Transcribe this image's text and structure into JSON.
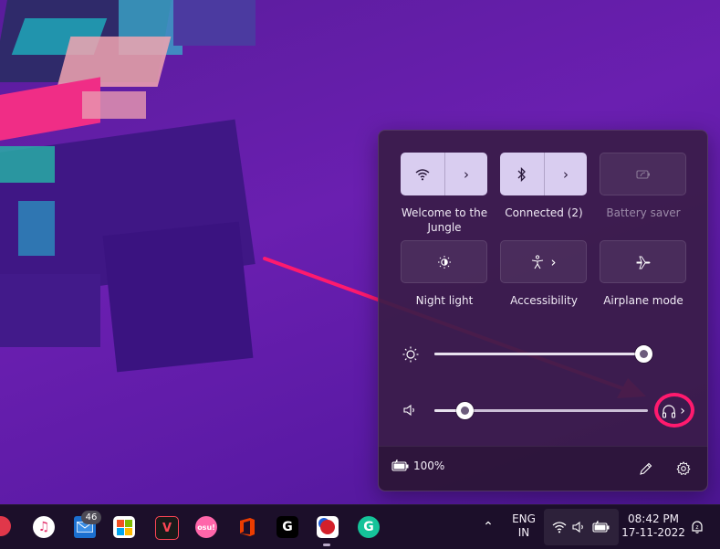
{
  "quick_settings": {
    "tiles": [
      {
        "label": "Welcome to the Jungle",
        "icon": "wifi-icon",
        "active": true
      },
      {
        "label": "Connected (2)",
        "icon": "bluetooth-icon",
        "active": true
      },
      {
        "label": "Battery saver",
        "icon": "battery-saver-icon",
        "active": false
      },
      {
        "label": "Night light",
        "icon": "night-light-icon",
        "active": false
      },
      {
        "label": "Accessibility",
        "icon": "accessibility-icon",
        "active": false
      },
      {
        "label": "Airplane mode",
        "icon": "airplane-icon",
        "active": false
      }
    ],
    "brightness": {
      "icon": "sun-icon",
      "level": 0.98
    },
    "volume": {
      "icon": "speaker-icon",
      "level": 0.14,
      "output_icon": "headphones-icon"
    },
    "footer": {
      "battery_text": "100%",
      "edit_icon": "pencil-icon",
      "settings_icon": "gear-icon"
    }
  },
  "taskbar": {
    "mail_badge": "46",
    "lang_line1": "ENG",
    "lang_line2": "IN",
    "time": "08:42 PM",
    "date": "17-11-2022",
    "osu_label": "osu!"
  },
  "colors": {
    "accent": "#d9cdf0",
    "annotation": "#ff1a6e"
  }
}
